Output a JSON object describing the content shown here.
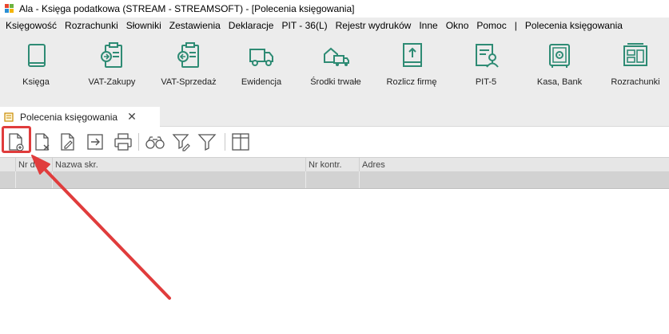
{
  "window": {
    "title": "Ala - Księga podatkowa (STREAM - STREAMSOFT) - [Polecenia księgowania]"
  },
  "menu": [
    "Księgowość",
    "Rozrachunki",
    "Słowniki",
    "Zestawienia",
    "Deklaracje",
    "PIT - 36(L)",
    "Rejestr wydruków",
    "Inne",
    "Okno",
    "Pomoc",
    "|",
    "Polecenia księgowania"
  ],
  "ribbon": [
    {
      "label": "Księga",
      "icon": "book-icon"
    },
    {
      "label": "VAT-Zakupy",
      "icon": "vat-purchase-icon"
    },
    {
      "label": "VAT-Sprzedaż",
      "icon": "vat-sales-icon"
    },
    {
      "label": "Ewidencja",
      "icon": "truck-icon"
    },
    {
      "label": "Środki trwałe",
      "icon": "fixed-assets-icon"
    },
    {
      "label": "Rozlicz firmę",
      "icon": "settle-company-icon"
    },
    {
      "label": "PIT-5",
      "icon": "pit-document-icon"
    },
    {
      "label": "Kasa, Bank",
      "icon": "safe-icon"
    },
    {
      "label": "Rozrachunki",
      "icon": "settlements-icon"
    }
  ],
  "tab": {
    "label": "Polecenia księgowania",
    "close": "✕"
  },
  "toolbar": [
    {
      "name": "new-document-icon"
    },
    {
      "name": "delete-document-icon"
    },
    {
      "name": "edit-document-icon"
    },
    {
      "name": "export-icon"
    },
    {
      "name": "print-icon"
    },
    {
      "name": "binoculars-icon"
    },
    {
      "name": "filter-edit-icon"
    },
    {
      "name": "filter-icon"
    },
    {
      "name": "columns-icon"
    }
  ],
  "grid": {
    "columns": [
      "Nr dok.",
      "Nazwa skr.",
      "Nr kontr.",
      "Adres"
    ]
  },
  "colors": {
    "accent": "#2e8b74",
    "highlight": "#e03c3c",
    "ribbon_bg": "#ececec"
  }
}
